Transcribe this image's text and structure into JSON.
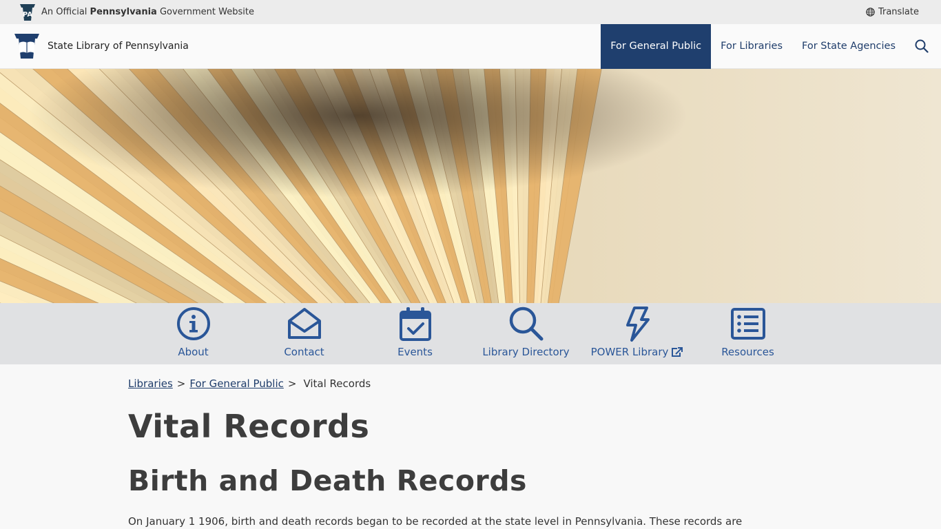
{
  "official_bar": {
    "keystone_text": "PA",
    "text_prefix": "An Official ",
    "text_bold": "Pennsylvania",
    "text_suffix": " Government Website",
    "translate_label": "Translate"
  },
  "header": {
    "site_name": "State Library of Pennsylvania",
    "nav": [
      {
        "label": "For General Public",
        "active": true
      },
      {
        "label": "For Libraries",
        "active": false
      },
      {
        "label": "For State Agencies",
        "active": false
      }
    ],
    "search_icon": "search-icon"
  },
  "quick_links": [
    {
      "label": "About",
      "icon": "info-icon"
    },
    {
      "label": "Contact",
      "icon": "envelope-icon"
    },
    {
      "label": "Events",
      "icon": "calendar-check-icon"
    },
    {
      "label": "Library Directory",
      "icon": "search-icon"
    },
    {
      "label": "POWER Library",
      "icon": "lightning-icon",
      "external": true
    },
    {
      "label": "Resources",
      "icon": "list-icon"
    }
  ],
  "breadcrumb": {
    "items": [
      "Libraries",
      "For General Public"
    ],
    "separator": ">",
    "current": "Vital Records"
  },
  "main": {
    "title": "Vital Records",
    "section_title": "Birth and Death Records",
    "intro": "On January 1 1906, birth and death records began to be recorded at the state level in Pennsylvania. These records are"
  },
  "colors": {
    "nav_active_bg": "#1f3f6e",
    "link": "#1f3d6b",
    "quick_link": "#2a5698",
    "quick_bar_bg": "#e0e1e3"
  }
}
